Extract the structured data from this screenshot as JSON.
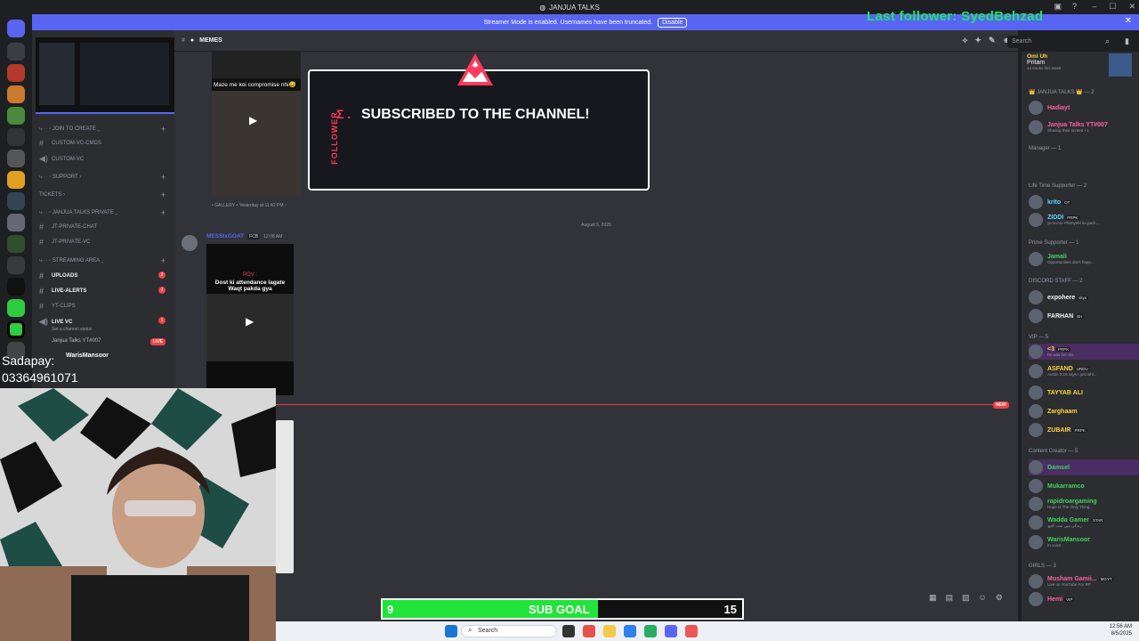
{
  "window": {
    "title": "JANJUA TALKS"
  },
  "banner": {
    "text": "Streamer Mode is enabled. Usernames have been truncated.",
    "button": "Disable"
  },
  "overlay": {
    "last_follower": "Last follower: SyedBehzad"
  },
  "header": {
    "channel": "MEMES",
    "search_placeholder": "Search"
  },
  "sidebar": {
    "join_to_create": "JOIN TO CREATE",
    "custom_vc_cmds": "CUSTOM-VC-CMDS",
    "custom_vc": "CUSTOM-VC",
    "support": "SUPPORT",
    "tickets": "TICKETS",
    "private_cat": "JANJUA TALKS PRIVATE",
    "jt_private_chat": "JT-PRIVATE-CHAT",
    "jt_private_vc": "JT-PRIVATE-VC",
    "streaming_area": "STREAMING AREA",
    "uploads": "UPLOADS",
    "uploads_badge": "2",
    "live_alerts": "LIVE-ALERTS",
    "live_alerts_badge": "3",
    "yt_clips": "YT-CLIPS",
    "live_vc": "LIVE VC",
    "live_vc_badge": "1",
    "channel_status": "Set a channel status",
    "vc_user1": "Janjua Talks YT#007",
    "vc_user1_tag": "LIVE",
    "vc_user2": "WarisMansoor"
  },
  "chat": {
    "video1_caption": "Maze me koi compromise nhi😅",
    "card_sigma": "Σ .",
    "card_title": "SUBSCRIBED TO THE CHANNEL!",
    "card_side": "FOLLOWER",
    "meta1": "• GALLERY • Yesterday at 11:42 PM ›",
    "date_divider": "August 5, 2025",
    "msg_author": "MESSIxGOAT",
    "msg_tag": "FCB",
    "msg_time": "12:08 AM",
    "video2_top": "POV :",
    "video2_caption": "Dost ki attendance lagate Waqt pakda gya",
    "new_tag": "NEW"
  },
  "members": {
    "now_playing": {
      "name": "Omi Uh",
      "user": "Pritam",
      "sub": "14 tracks this week"
    },
    "sections": [
      {
        "label": "👑 JANJUA TALKS 👑 — 2"
      },
      {
        "label": "Manager — 1"
      },
      {
        "label": "Life Time Supporter — 2"
      },
      {
        "label": "Prime Supporter — 1"
      },
      {
        "label": "DISCORD STAFF — 2"
      },
      {
        "label": "VIP — 5"
      },
      {
        "label": "Content Creator — 5"
      },
      {
        "label": "GIRLS — 3"
      }
    ],
    "list": [
      {
        "name": "Hadiayt",
        "status": "",
        "tag": "",
        "color": "#ff5fa2"
      },
      {
        "name": "Janjua Talks YT#007",
        "status": "Sharing their screen +1",
        "tag": "",
        "color": "#ff5fa2"
      },
      {
        "name": "krito",
        "status": "",
        "tag": "OT",
        "color": "#5ad8ff"
      },
      {
        "name": "ZIDDI",
        "status": "ye koi se Phenyebi ka pack...",
        "tag": "PRPK",
        "color": "#5ad8ff"
      },
      {
        "name": "Jamali",
        "status": "Opportunities don't happ...",
        "tag": "",
        "color": "#46d160"
      },
      {
        "name": "expohere",
        "status": "",
        "tag": "skys",
        "color": "#f2f3f5"
      },
      {
        "name": "FARHAN",
        "status": "",
        "tag": "BH",
        "color": "#f2f3f5"
      },
      {
        "name": "<3",
        "status": "he was her sin.",
        "tag": "PRPK",
        "color": "#ffd43b"
      },
      {
        "name": "ASFAND",
        "status": "Austin 3:16 says I just whi...",
        "tag": "URDU",
        "color": "#ffd43b"
      },
      {
        "name": "TAYYAB ALI",
        "status": "",
        "tag": "",
        "color": "#ffd43b"
      },
      {
        "name": "Zarghaam",
        "status": "",
        "tag": "",
        "color": "#ffd43b"
      },
      {
        "name": "ZUBAIR",
        "status": "",
        "tag": "PRPK",
        "color": "#ffd43b"
      },
      {
        "name": "Damsel",
        "status": "",
        "tag": "",
        "color": "#46d160"
      },
      {
        "name": "Mukarramco",
        "status": "",
        "tag": "",
        "color": "#46d160"
      },
      {
        "name": "rapidroargaming",
        "status": "Hope Is The Only Thing...",
        "tag": "",
        "color": "#46d160"
      },
      {
        "name": "Wadda Gamer",
        "status": "زندگی میں سب کچھ",
        "tag": "STAR",
        "color": "#46d160"
      },
      {
        "name": "WarisMansoor",
        "status": "In voice",
        "tag": "",
        "color": "#46d160"
      },
      {
        "name": "Musham Gamii...",
        "status": "Live on YouTube For RP",
        "tag": "MGYT",
        "color": "#ff5fa2"
      },
      {
        "name": "Hemi",
        "status": "",
        "tag": "VIP",
        "color": "#ff5fa2"
      }
    ]
  },
  "stream": {
    "sadapay_label": "Sadapay:",
    "sadapay_number": "03364961071",
    "sub_goal": {
      "current": "9",
      "label": "SUB GOAL",
      "target": "15",
      "progress": 0.6
    }
  },
  "taskbar": {
    "search": "Search",
    "time": "12:56 AM",
    "date": "8/5/2025"
  },
  "colors": {
    "accent": "#5865f2",
    "live": "#f23f43",
    "goal": "#22e33a",
    "follower": "#22e36a"
  }
}
